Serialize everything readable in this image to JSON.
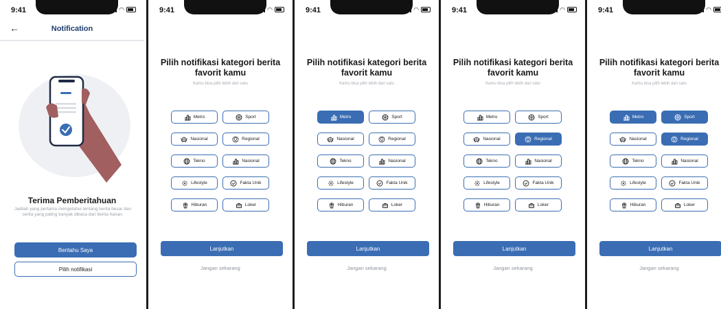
{
  "status": {
    "time": "9:41"
  },
  "screen1": {
    "title": "Notification",
    "heading": "Terima Pemberitahuan",
    "description": "Jadilah yang pertama mengetahui tentang berita besar dan cerita yang paling banyak dibaca dari berita harian.",
    "primary_button": "Beritahu Saya",
    "secondary_button": "Pilih notifikasi"
  },
  "category": {
    "title": "Pilih notifikasi kategori berita favorit kamu",
    "subtitle": "Kamu bisa pilih lebih dari satu",
    "continue_button": "Lanjutkan",
    "skip_link": "Jangan sekarang",
    "chips": [
      {
        "label": "Metro",
        "icon": "buildings-icon"
      },
      {
        "label": "Sport",
        "icon": "ball-icon"
      },
      {
        "label": "Nasional",
        "icon": "globe-emblem-icon"
      },
      {
        "label": "Regional",
        "icon": "location-pin-icon"
      },
      {
        "label": "Tekno",
        "icon": "globe-icon"
      },
      {
        "label": "Nasional",
        "icon": "buildings-icon"
      },
      {
        "label": "Lifestyle",
        "icon": "sparkle-icon"
      },
      {
        "label": "Fakta Unik",
        "icon": "check-circle-icon"
      },
      {
        "label": "Hiburan",
        "icon": "popcorn-icon"
      },
      {
        "label": "Loker",
        "icon": "briefcase-icon"
      }
    ]
  },
  "screens": [
    {
      "selected": []
    },
    {
      "selected": [
        0
      ]
    },
    {
      "selected": [
        3
      ]
    },
    {
      "selected": [
        0,
        1,
        3
      ]
    }
  ],
  "colors": {
    "primary": "#3a6db3",
    "text": "#1a1a1a",
    "muted": "#9aa0a8"
  }
}
